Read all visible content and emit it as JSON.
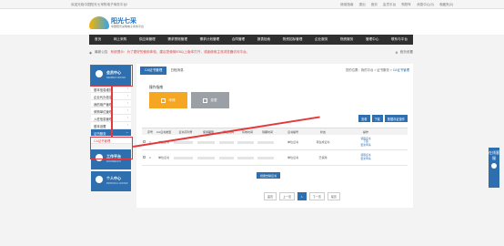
{
  "topbar": {
    "welcome": "欢迎光临中国阳光七采购电子商务平台!",
    "links": [
      "使用指南",
      "退出",
      "首页",
      "会员平台",
      "购物车",
      "消息中心(0)",
      "收藏夹(0)"
    ]
  },
  "logo": {
    "name": "阳光七采",
    "sub": "中国阳光采购电子商务平台"
  },
  "nav": [
    "首页",
    "网上采购",
    "供应商管理",
    "需求预测管理",
    "需求计划管理",
    "合同管理",
    "报表检索",
    "物资招标管理",
    "企业服务",
    "物资服务",
    "管理中心",
    "联系与平台"
  ],
  "system_bar": {
    "label": "最新公告",
    "notice": "系统提示：为了更好的使用体验，建议您使用IE8以上版本打开，或者使用主流浏览器访问平台。",
    "settings": "首页设置"
  },
  "sidebar": {
    "member_center": {
      "title": "会员中心",
      "sub": "MEMBER CENTER"
    },
    "items": [
      "基本信息维护",
      "企业代办信息",
      "我的用户管理",
      "采购单位管理",
      "入驻信息管理",
      "基本设置"
    ],
    "cert_section": "证书服务",
    "cert_sub": "CA证书管理",
    "workbench": {
      "title": "工作平台",
      "sub": "WORKBENCH"
    },
    "personal": {
      "title": "个人中心",
      "sub": "PERSONAL CENTER"
    }
  },
  "main": {
    "tab_active": "CA证书管理",
    "tab_other": "日程消息",
    "breadcrumb_prefix": "您的位置：我的平台 > 证书服务 >",
    "breadcrumb_current": "CA证书管理",
    "section_title": "操作指南",
    "btn_apply": "申请",
    "btn_change": "变更",
    "toolbar": [
      "查看",
      "下载",
      "数据存证操作"
    ],
    "columns": [
      "",
      "序号",
      "CA证书类型",
      "证书序列号",
      "使用期限",
      "颁发机构",
      "有效时间",
      "到期时间",
      "证书编号",
      "状态",
      "操作"
    ],
    "rows": [
      {
        "no": "1",
        "type": "单位证书",
        "valid": "",
        "exp": "",
        "num": "单位证书",
        "status": "待生成证书",
        "ops": [
          "领取证书",
          "下载",
          "更新申请"
        ]
      },
      {
        "no": "2",
        "type": "单位证书",
        "valid": "",
        "exp": "",
        "num": "单位证书",
        "status": "已使用",
        "ops": [
          "领取证书",
          "更新申请"
        ]
      }
    ],
    "remove_btn": "批量去除证书",
    "pager": [
      "首页",
      "上一页",
      "1",
      "下一页",
      "尾页"
    ]
  },
  "float_service": "在线客服"
}
